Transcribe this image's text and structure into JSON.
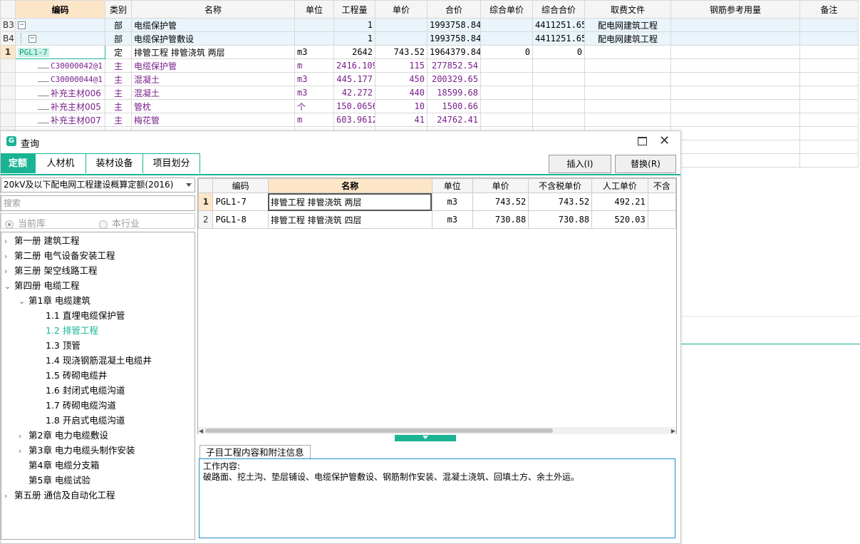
{
  "main_grid": {
    "columns": [
      "",
      "编码",
      "类别",
      "名称",
      "单位",
      "工程量",
      "单价",
      "合价",
      "综合单价",
      "综合合价",
      "取费文件",
      "钢筋参考用量",
      "备注"
    ],
    "rows": [
      {
        "rownum": "B3",
        "code": "",
        "type": "部",
        "name": "电缆保护管",
        "unit": "",
        "qty": "1",
        "price": "",
        "total": "1993758.84",
        "cprice": "",
        "ctotal": "4411251.65",
        "fee": "配电网建筑工程"
      },
      {
        "rownum": "B4",
        "code": "",
        "type": "部",
        "name": "电缆保护管敷设",
        "unit": "",
        "qty": "1",
        "price": "",
        "total": "1993758.84",
        "cprice": "",
        "ctotal": "4411251.65",
        "fee": "配电网建筑工程"
      },
      {
        "rownum": "1",
        "code": "PGL1-7",
        "type": "定",
        "name": "排管工程 排管浇筑 两层",
        "unit": "m3",
        "qty": "2642",
        "price": "743.52",
        "total": "1964379.84",
        "cprice": "0",
        "ctotal": "0",
        "fee": ""
      },
      {
        "rownum": "",
        "code": "C30000042@1",
        "type": "主",
        "name": "电缆保护管",
        "unit": "m",
        "qty": "2416.109",
        "price": "115",
        "total": "277852.54",
        "cprice": "",
        "ctotal": "",
        "fee": ""
      },
      {
        "rownum": "",
        "code": "C30000044@1",
        "type": "主",
        "name": "混凝土",
        "unit": "m3",
        "qty": "445.177",
        "price": "450",
        "total": "200329.65",
        "cprice": "",
        "ctotal": "",
        "fee": ""
      },
      {
        "rownum": "",
        "code": "补充主材006",
        "type": "主",
        "name": "混凝土",
        "unit": "m3",
        "qty": "42.272",
        "price": "440",
        "total": "18599.68",
        "cprice": "",
        "ctotal": "",
        "fee": ""
      },
      {
        "rownum": "",
        "code": "补充主材005",
        "type": "主",
        "name": "管枕",
        "unit": "个",
        "qty": "150.0656",
        "price": "10",
        "total": "1500.66",
        "cprice": "",
        "ctotal": "",
        "fee": ""
      },
      {
        "rownum": "",
        "code": "补充主材007",
        "type": "主",
        "name": "梅花管",
        "unit": "m",
        "qty": "603.9612",
        "price": "41",
        "total": "24762.41",
        "cprice": "",
        "ctotal": "",
        "fee": ""
      }
    ]
  },
  "dialog": {
    "app_logo_letter": "G",
    "title": "查询",
    "tabs": [
      "定额",
      "人材机",
      "装材设备",
      "项目划分"
    ],
    "insert_label": "插入(I)",
    "replace_label": "替换(R)",
    "library": "20kV及以下配电网工程建设概算定额(2016)",
    "search_placeholder": "搜索",
    "radio_current": "当前库",
    "radio_industry": "本行业",
    "tree": [
      {
        "label": "第一册  建筑工程",
        "level": 0,
        "chev": "right"
      },
      {
        "label": "第二册  电气设备安装工程",
        "level": 0,
        "chev": "right"
      },
      {
        "label": "第三册  架空线路工程",
        "level": 0,
        "chev": "right"
      },
      {
        "label": "第四册  电缆工程",
        "level": 0,
        "chev": "down"
      },
      {
        "label": "第1章  电缆建筑",
        "level": 1,
        "chev": "down"
      },
      {
        "label": "1.1  直埋电缆保护管",
        "level": 2,
        "chev": ""
      },
      {
        "label": "1.2  排管工程",
        "level": 2,
        "chev": "",
        "selected": true
      },
      {
        "label": "1.3  顶管",
        "level": 2,
        "chev": ""
      },
      {
        "label": "1.4  现浇钢筋混凝土电缆井",
        "level": 2,
        "chev": ""
      },
      {
        "label": "1.5  砖砌电缆井",
        "level": 2,
        "chev": ""
      },
      {
        "label": "1.6  封闭式电缆沟道",
        "level": 2,
        "chev": ""
      },
      {
        "label": "1.7  砖砌电缆沟道",
        "level": 2,
        "chev": ""
      },
      {
        "label": "1.8  开启式电缆沟道",
        "level": 2,
        "chev": ""
      },
      {
        "label": "第2章  电力电缆敷设",
        "level": 1,
        "chev": "right"
      },
      {
        "label": "第3章  电力电缆头制作安装",
        "level": 1,
        "chev": "right"
      },
      {
        "label": "第4章  电缆分支箱",
        "level": 1,
        "chev": ""
      },
      {
        "label": "第5章  电缆试验",
        "level": 1,
        "chev": ""
      },
      {
        "label": "第五册  通信及自动化工程",
        "level": 0,
        "chev": "right"
      }
    ],
    "result_columns": [
      "",
      "编码",
      "名称",
      "单位",
      "单价",
      "不含税单价",
      "人工单价",
      "不含"
    ],
    "results": [
      {
        "n": "1",
        "code": "PGL1-7",
        "name": "排管工程 排管浇筑 两层",
        "unit": "m3",
        "price": "743.52",
        "notax": "743.52",
        "labor": "492.21"
      },
      {
        "n": "2",
        "code": "PGL1-8",
        "name": "排管工程 排管浇筑 四层",
        "unit": "m3",
        "price": "730.88",
        "notax": "730.88",
        "labor": "520.03"
      }
    ],
    "info_tab": "子目工程内容和附注信息",
    "work_content_label": "工作内容:",
    "work_content": "破路面、挖土沟、垫层铺设、电缆保护管敷设、钢筋制作安装、混凝土浇筑、回填土方、余土外运。"
  },
  "colors": {
    "accent": "#1ab394",
    "header_active": "#fde6c8",
    "purple": "#7a1f8c",
    "info_border": "#1a8fd1"
  }
}
